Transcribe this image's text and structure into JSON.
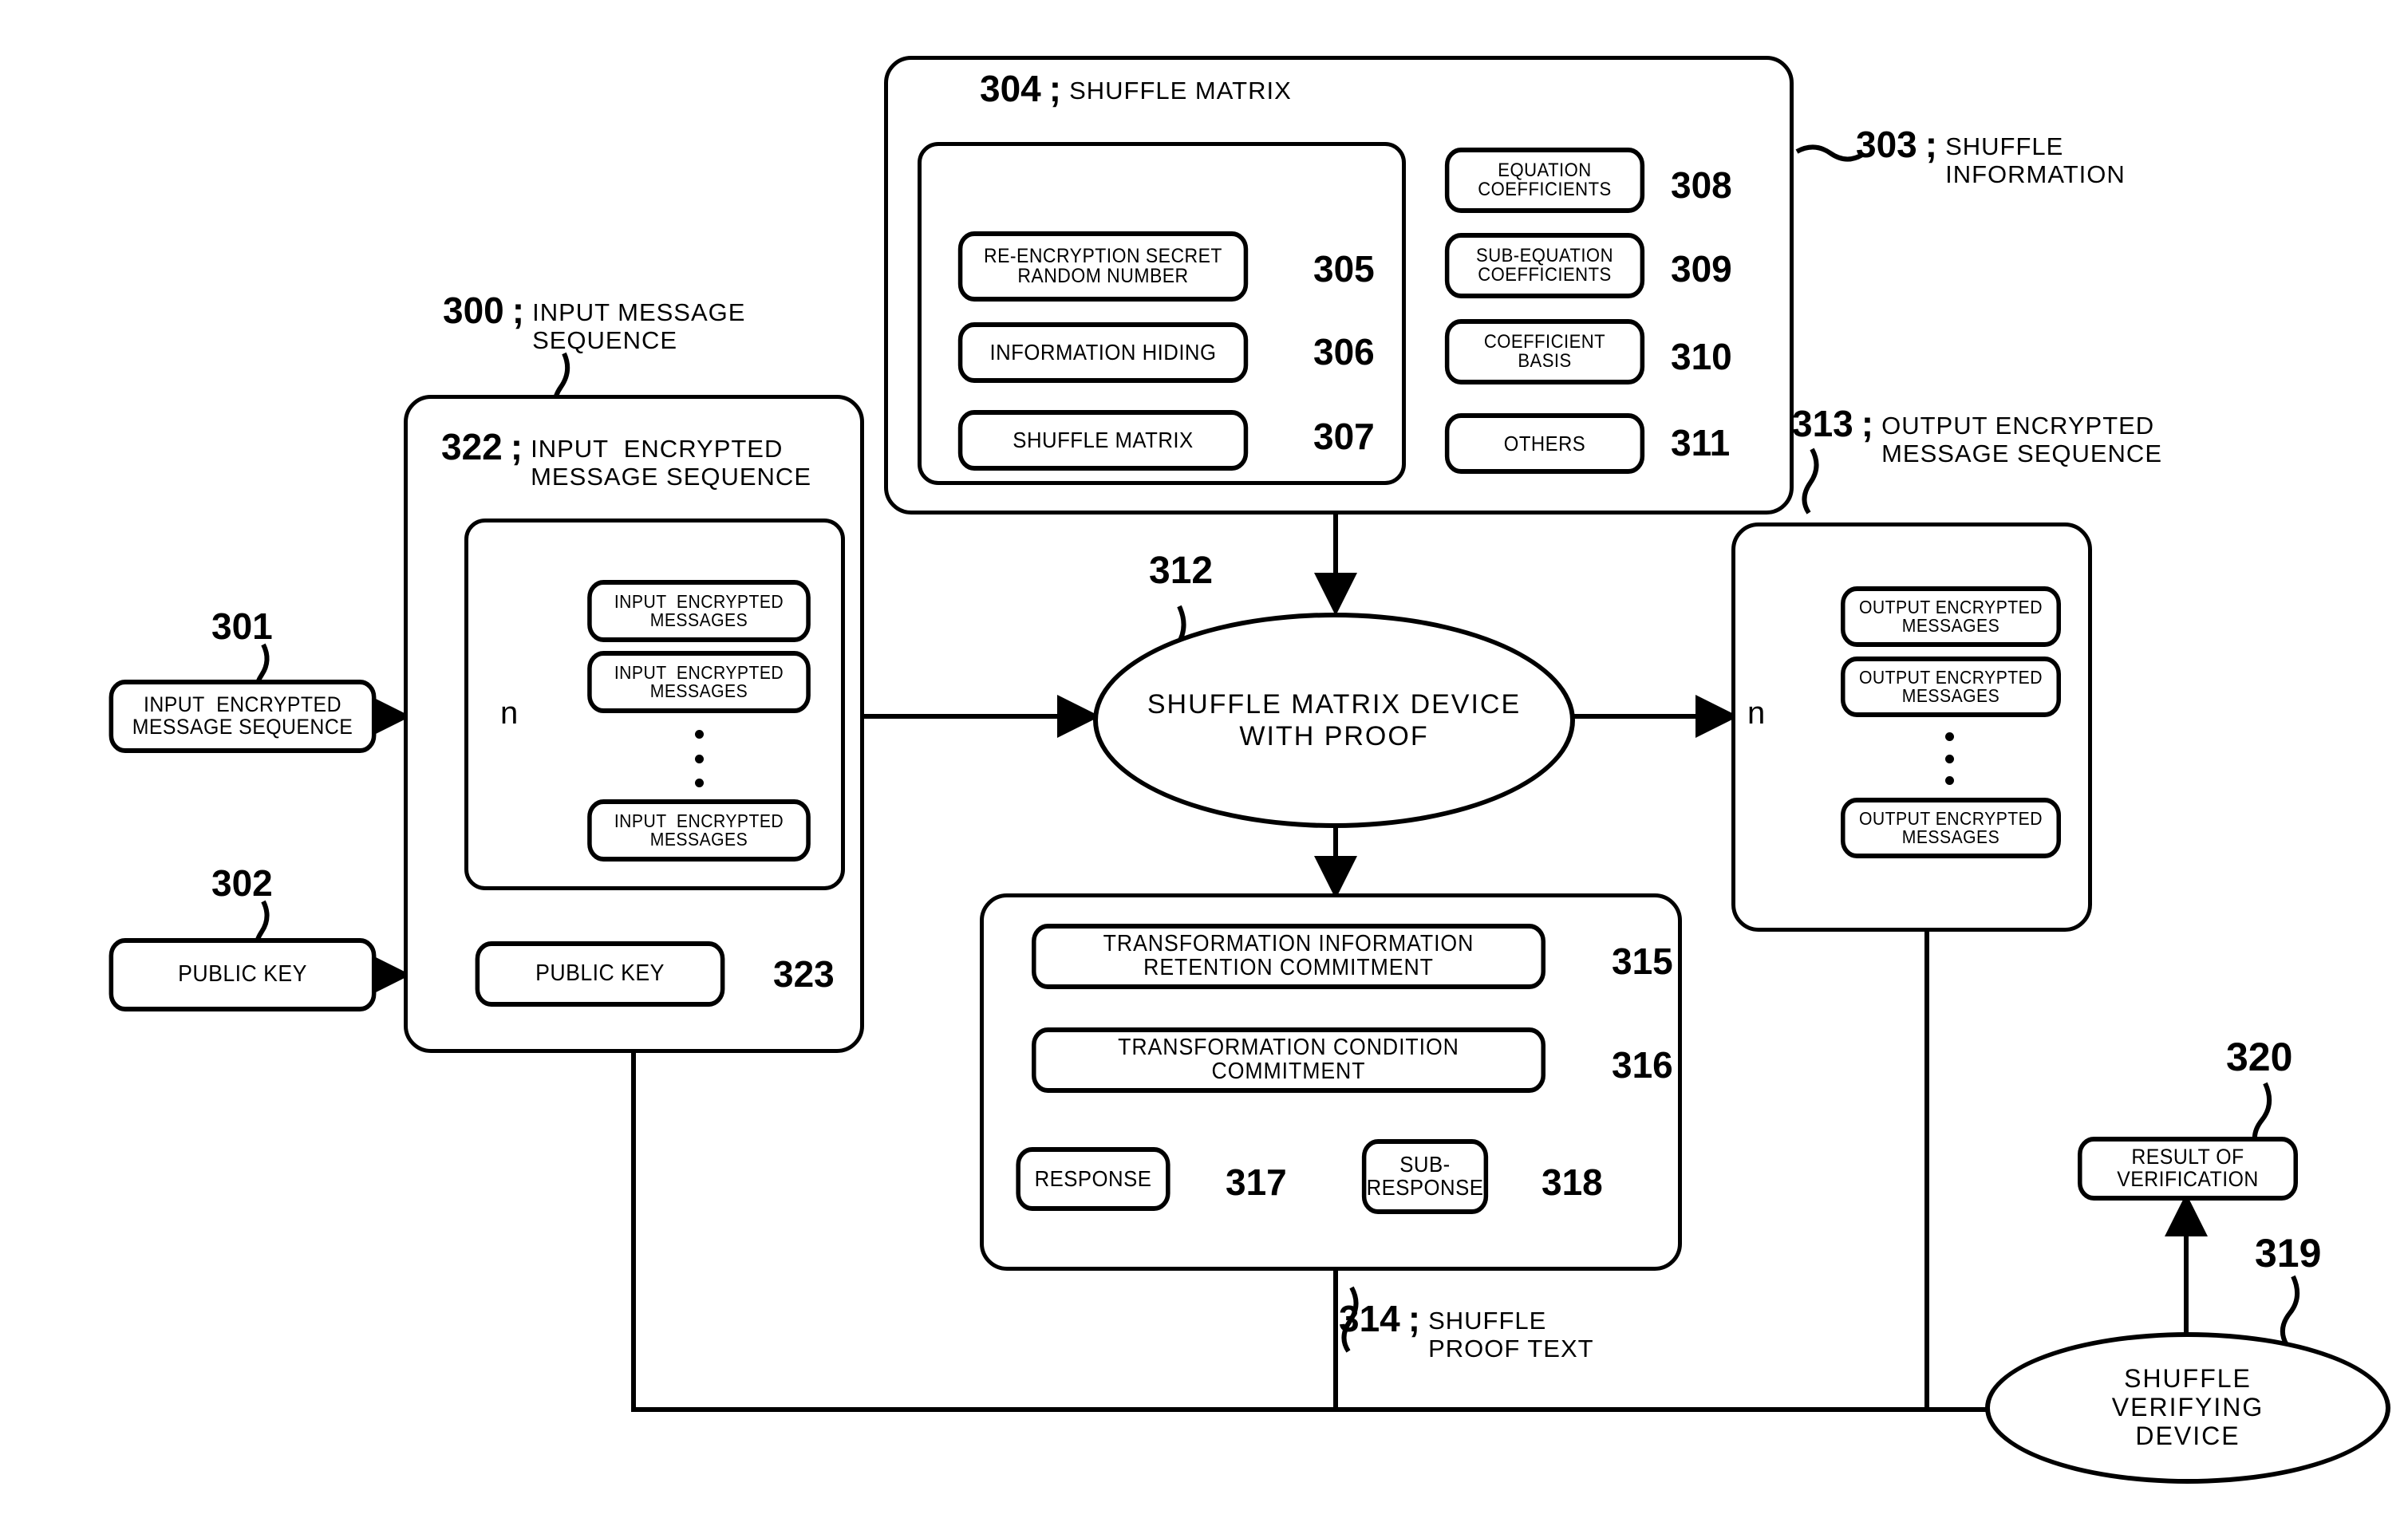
{
  "figure": {
    "type": "patent-block-diagram",
    "title": "Shuffle matrix device with proof block diagram"
  },
  "input_source": {
    "ref": "301",
    "label": "INPUT  ENCRYPTED\nMESSAGE SEQUENCE"
  },
  "public_key_source": {
    "ref": "302",
    "label": "PUBLIC KEY"
  },
  "input_message_sequence": {
    "ref": "300",
    "caption": "INPUT MESSAGE\nSEQUENCE",
    "inner": {
      "ref": "322",
      "caption": "INPUT  ENCRYPTED\nMESSAGE SEQUENCE",
      "count_label": "n",
      "items": [
        "INPUT  ENCRYPTED\nMESSAGES",
        "INPUT  ENCRYPTED\nMESSAGES",
        "INPUT  ENCRYPTED\nMESSAGES"
      ]
    },
    "public_key": {
      "ref": "323",
      "label": "PUBLIC KEY"
    }
  },
  "shuffle_information": {
    "ref": "303",
    "caption": "SHUFFLE\nINFORMATION",
    "shuffle_matrix_group": {
      "ref": "304",
      "caption": "SHUFFLE MATRIX",
      "items": [
        {
          "ref": "305",
          "label": "RE-ENCRYPTION SECRET\nRANDOM NUMBER"
        },
        {
          "ref": "306",
          "label": "INFORMATION HIDING"
        },
        {
          "ref": "307",
          "label": "SHUFFLE MATRIX"
        }
      ]
    },
    "right_items": [
      {
        "ref": "308",
        "label": "EQUATION\nCOEFFICIENTS"
      },
      {
        "ref": "309",
        "label": "SUB-EQUATION\nCOEFFICIENTS"
      },
      {
        "ref": "310",
        "label": "COEFFICIENT\nBASIS"
      },
      {
        "ref": "311",
        "label": "OTHERS"
      }
    ]
  },
  "shuffle_device": {
    "ref": "312",
    "label": "SHUFFLE MATRIX DEVICE\nWITH PROOF"
  },
  "output_message_sequence": {
    "ref": "313",
    "caption": "OUTPUT ENCRYPTED\nMESSAGE SEQUENCE",
    "count_label": "n",
    "items": [
      "OUTPUT ENCRYPTED\nMESSAGES",
      "OUTPUT ENCRYPTED\nMESSAGES",
      "OUTPUT ENCRYPTED\nMESSAGES"
    ]
  },
  "shuffle_proof_text": {
    "ref": "314",
    "caption": "SHUFFLE\nPROOF TEXT",
    "items": [
      {
        "ref": "315",
        "label": "TRANSFORMATION INFORMATION\nRETENTION COMMITMENT"
      },
      {
        "ref": "316",
        "label": "TRANSFORMATION CONDITION\nCOMMITMENT"
      },
      {
        "ref": "317",
        "label": "RESPONSE"
      },
      {
        "ref": "318",
        "label": "SUB-\nRESPONSE"
      }
    ]
  },
  "verifying_device": {
    "ref": "319",
    "label": "SHUFFLE\nVERIFYING\nDEVICE"
  },
  "verification_result": {
    "ref": "320",
    "label": "RESULT OF\nVERIFICATION"
  },
  "colors": {
    "ink": "#000000",
    "paper": "#ffffff"
  }
}
